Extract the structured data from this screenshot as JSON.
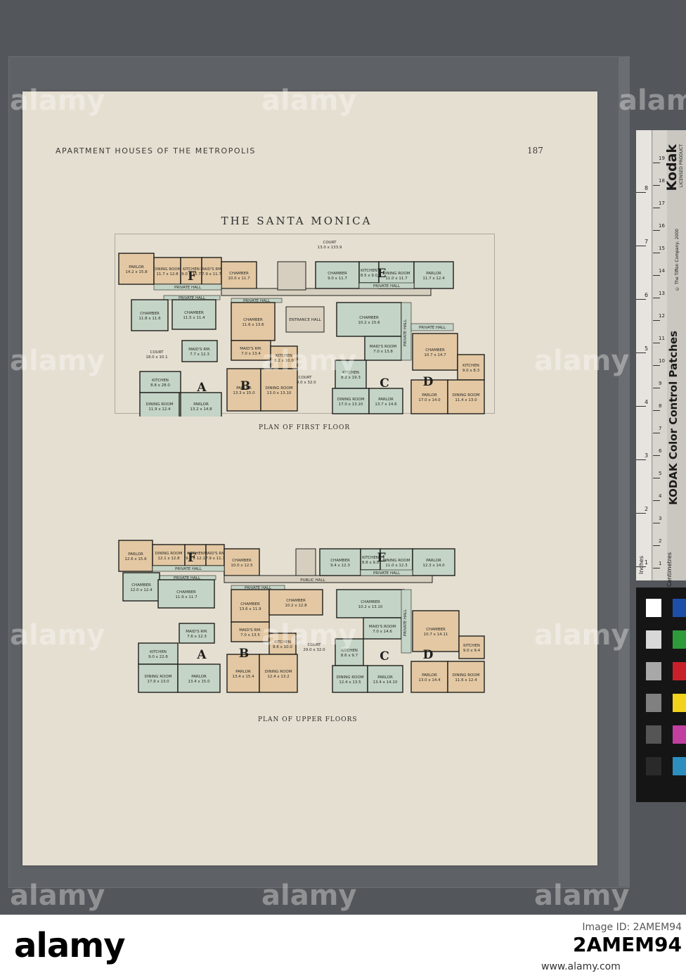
{
  "page": {
    "running_head": "APARTMENT HOUSES OF THE METROPOLIS",
    "page_number": "187",
    "title": "THE SANTA MONICA"
  },
  "plans": [
    {
      "caption": "PLAN OF FIRST FLOOR",
      "court_top": "COURT",
      "court_top_dims": "13.0 x 133.9",
      "court_mid": "COURT",
      "court_mid_dims": "29.0 x 32.0",
      "court_left": "COURT",
      "court_left_dims": "18.0 x 10.1",
      "entrance": "ENTRANCE HALL",
      "rooms": [
        {
          "name": "PARLOR",
          "dims": "14.2 x 15.8"
        },
        {
          "name": "DINING ROOM",
          "dims": "11.7 x 12.8"
        },
        {
          "name": "KITCHEN",
          "dims": "9.0 x 11.7"
        },
        {
          "name": "MAID'S RM.",
          "dims": "7.9 x 11.7"
        },
        {
          "name": "CHAMBER",
          "dims": "10.0 x 11.7"
        },
        {
          "name": "CHAMBER",
          "dims": "11.8 x 11.6"
        },
        {
          "name": "CHAMBER",
          "dims": "11.5 x 11.4"
        },
        {
          "name": "MAID'S RM.",
          "dims": "7.7 x 12.3"
        },
        {
          "name": "KITCHEN",
          "dims": "8.8 x 28.0"
        },
        {
          "name": "DINING ROOM",
          "dims": "11.9 x 12.4"
        },
        {
          "name": "PARLOR",
          "dims": "13.2 x 14.8"
        },
        {
          "name": "CHAMBER",
          "dims": "11.6 x 13.6"
        },
        {
          "name": "MAID'S RM.",
          "dims": "7.0 x 13.4"
        },
        {
          "name": "KITCHEN",
          "dims": "8.2 x 10.0"
        },
        {
          "name": "PARLOR",
          "dims": "13.3 x 15.0"
        },
        {
          "name": "DINING ROOM",
          "dims": "13.0 x 13.10"
        },
        {
          "name": "CHAMBER",
          "dims": "9.0 x 11.7"
        },
        {
          "name": "KITCHEN",
          "dims": "8.5 x 9.0"
        },
        {
          "name": "DINING ROOM",
          "dims": "11.0 x 11.7"
        },
        {
          "name": "PARLOR",
          "dims": "11.7 x 12.4"
        },
        {
          "name": "CHAMBER",
          "dims": "10.2 x 15.6"
        },
        {
          "name": "MAID'S ROOM",
          "dims": "7.0 x 13.8"
        },
        {
          "name": "KITCHEN",
          "dims": "8.2 x 19.3"
        },
        {
          "name": "DINING ROOM",
          "dims": "17.0 x 13.10"
        },
        {
          "name": "PARLOR",
          "dims": "13.7 x 14.6"
        },
        {
          "name": "CHAMBER",
          "dims": "10.7 x 14.7"
        },
        {
          "name": "KITCHEN",
          "dims": "9.0 x 8.3"
        },
        {
          "name": "PARLOR",
          "dims": "17.0 x 14.0"
        },
        {
          "name": "DINING ROOM",
          "dims": "11.4 x 13.0"
        }
      ],
      "halls": [
        "PRIVATE HALL",
        "PRIVATE HALL",
        "PRIVATE HALL",
        "PRIVATE HALL",
        "PRIVATE HALL",
        "PRIVATE HALL"
      ],
      "units": [
        "F",
        "E",
        "A",
        "B",
        "C",
        "D"
      ]
    },
    {
      "caption": "PLAN OF UPPER FLOORS",
      "court_mid": "COURT",
      "court_mid_dims": "29.0 x 32.0",
      "public_hall": "PUBLIC HALL",
      "rooms": [
        {
          "name": "PARLOR",
          "dims": "12.6 x 15.6"
        },
        {
          "name": "DINING ROOM",
          "dims": "12.1 x 12.8"
        },
        {
          "name": "KITCHEN",
          "dims": "9.0 x 12.1"
        },
        {
          "name": "MAID'S RM.",
          "dims": "7.9 x 11.7"
        },
        {
          "name": "CHAMBER",
          "dims": "10.0 x 12.5"
        },
        {
          "name": "CHAMBER",
          "dims": "12.0 x 12.4"
        },
        {
          "name": "CHAMBER",
          "dims": "11.9 x 11.7"
        },
        {
          "name": "MAID'S RM.",
          "dims": "7.6 x 12.3"
        },
        {
          "name": "KITCHEN",
          "dims": "9.0 x 22.6"
        },
        {
          "name": "DINING ROOM",
          "dims": "17.9 x 13.0"
        },
        {
          "name": "PARLOR",
          "dims": "13.4 x 15.0"
        },
        {
          "name": "CHAMBER",
          "dims": "13.6 x 11.9"
        },
        {
          "name": "MAID'S RM.",
          "dims": "7.0 x 13.5"
        },
        {
          "name": "KITCHEN",
          "dims": "8.6 x 10.0"
        },
        {
          "name": "PARLOR",
          "dims": "13.4 x 15.4"
        },
        {
          "name": "DINING ROOM",
          "dims": "12.4 x 13.2"
        },
        {
          "name": "CHAMBER",
          "dims": "10.2 x 12.8"
        },
        {
          "name": "CHAMBER",
          "dims": "9.4 x 12.3"
        },
        {
          "name": "KITCHEN",
          "dims": "8.8 x 9.0"
        },
        {
          "name": "DINING ROOM",
          "dims": "11.0 x 12.3"
        },
        {
          "name": "PARLOR",
          "dims": "12.3 x 14.0"
        },
        {
          "name": "CHAMBER",
          "dims": "10.2 x 13.10"
        },
        {
          "name": "MAID'S ROOM",
          "dims": "7.0 x 14.6"
        },
        {
          "name": "KITCHEN",
          "dims": "8.6 x 9.7"
        },
        {
          "name": "DINING ROOM",
          "dims": "12.4 x 13.5"
        },
        {
          "name": "PARLOR",
          "dims": "13.4 x 14.10"
        },
        {
          "name": "CHAMBER",
          "dims": "10.7 x 14.11"
        },
        {
          "name": "KITCHEN",
          "dims": "9.0 x 9.4"
        },
        {
          "name": "PARLOR",
          "dims": "13.0 x 14.4"
        },
        {
          "name": "DINING ROOM",
          "dims": "11.6 x 12.4"
        }
      ],
      "halls": [
        "PRIVATE HALL",
        "PRIVATE HALL",
        "PRIVATE HALL",
        "PRIVATE HALL",
        "PRIVATE HALL"
      ],
      "units": [
        "F",
        "E",
        "A",
        "B",
        "C",
        "D"
      ]
    }
  ],
  "color_card": {
    "brand": "Kodak",
    "licensed": "LICENSED PRODUCT",
    "copyright": "© The Tiffen Company, 2000",
    "patches_label": "KODAK Color Control Patches",
    "inches": "Inches",
    "centimetres": "Centimetres",
    "inch_ticks": [
      "1",
      "2",
      "3",
      "4",
      "5",
      "6",
      "7",
      "8"
    ],
    "cm_ticks": [
      "1",
      "2",
      "3",
      "4",
      "5",
      "6",
      "7",
      "8",
      "9",
      "10",
      "11",
      "12",
      "13",
      "14",
      "15",
      "16",
      "17",
      "18",
      "19"
    ],
    "swatch_colors_left": [
      "#ffffff",
      "#d8d8d8",
      "#a8a8a8",
      "#808080",
      "#555555",
      "#2a2a2a"
    ],
    "swatch_colors_right": [
      "#1d4fa8",
      "#2f9a3a",
      "#c8202a",
      "#f2d21c",
      "#c23fa0",
      "#2d8fc0"
    ]
  },
  "watermark": "alamy",
  "footer": {
    "logo": "alamy",
    "image_id_label": "Image ID: 2AMEM94",
    "image_code": "2AMEM94",
    "url": "www.alamy.com"
  },
  "colors": {
    "tan": "#e3c8a3",
    "green": "#c4d4c6",
    "wall": "#1f1f1d",
    "paper": "#e5dfd1"
  }
}
